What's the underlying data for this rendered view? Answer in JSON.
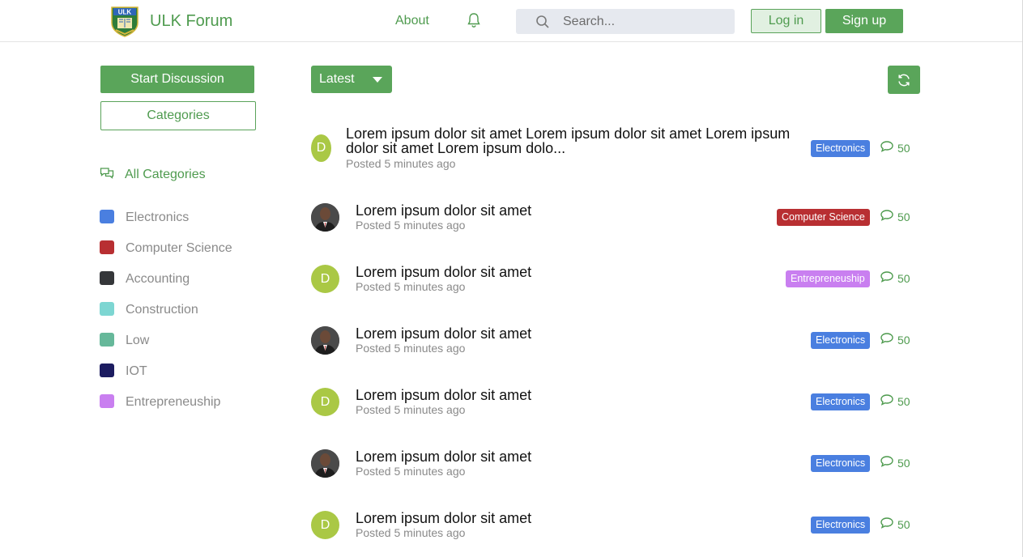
{
  "header": {
    "brand": "ULK Forum",
    "logo_text": "ULK",
    "nav_about": "About",
    "search_placeholder": "Search...",
    "login_label": "Log in",
    "signup_label": "Sign up"
  },
  "sidebar": {
    "start_label": "Start Discussion",
    "categories_label": "Categories",
    "all_categories_label": "All Categories",
    "categories": [
      {
        "label": "Electronics",
        "color": "#4a7fe0"
      },
      {
        "label": "Computer Science",
        "color": "#b82f32"
      },
      {
        "label": "Accounting",
        "color": "#35373a"
      },
      {
        "label": "Construction",
        "color": "#7dd6d2"
      },
      {
        "label": "Low",
        "color": "#66b89a"
      },
      {
        "label": "IOT",
        "color": "#1c1c60"
      },
      {
        "label": "Entrepreneuship",
        "color": "#c97ff0"
      }
    ]
  },
  "toolbar": {
    "sort_label": "Latest"
  },
  "discussions": [
    {
      "avatar": "D",
      "avatar_type": "letter",
      "title_line1": "Lorem ipsum dolor sit amet Lorem ipsum dolor sit amet Lorem ipsum",
      "title_line2": "dolor sit amet Lorem ipsum dolo...",
      "meta": "Posted 5 minutes ago",
      "tag": "Electronics",
      "tag_color": "#4a7fe0",
      "replies": "50"
    },
    {
      "avatar": "",
      "avatar_type": "photo",
      "title_line1": "Lorem ipsum dolor sit amet",
      "meta": "Posted 5 minutes ago",
      "tag": "Computer Science",
      "tag_color": "#b82f32",
      "replies": "50"
    },
    {
      "avatar": "D",
      "avatar_type": "letter",
      "title_line1": "Lorem ipsum dolor sit amet",
      "meta": "Posted 5 minutes ago",
      "tag": "Entrepreneuship",
      "tag_color": "#c97ff0",
      "replies": "50"
    },
    {
      "avatar": "",
      "avatar_type": "photo",
      "title_line1": "Lorem ipsum dolor sit amet",
      "meta": "Posted 5 minutes ago",
      "tag": "Electronics",
      "tag_color": "#4a7fe0",
      "replies": "50"
    },
    {
      "avatar": "D",
      "avatar_type": "letter",
      "title_line1": "Lorem ipsum dolor sit amet",
      "meta": "Posted 5 minutes ago",
      "tag": "Electronics",
      "tag_color": "#4a7fe0",
      "replies": "50"
    },
    {
      "avatar": "",
      "avatar_type": "photo",
      "title_line1": "Lorem ipsum dolor sit amet",
      "meta": "Posted 5 minutes ago",
      "tag": "Electronics",
      "tag_color": "#4a7fe0",
      "replies": "50"
    },
    {
      "avatar": "D",
      "avatar_type": "letter",
      "title_line1": "Lorem ipsum dolor sit amet",
      "meta": "Posted 5 minutes ago",
      "tag": "Electronics",
      "tag_color": "#4a7fe0",
      "replies": "50"
    }
  ]
}
